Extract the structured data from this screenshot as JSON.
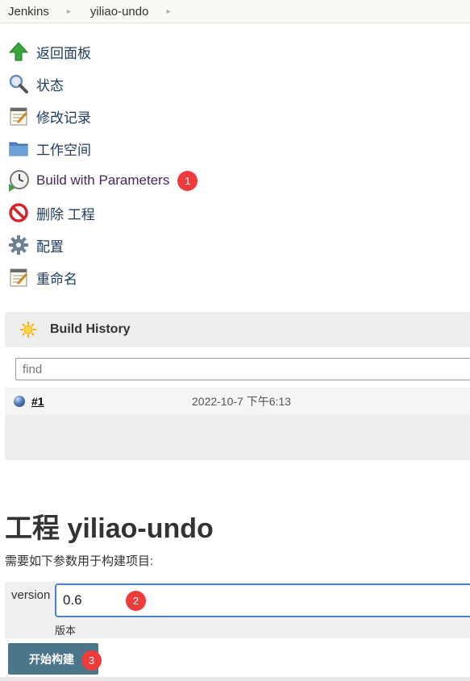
{
  "breadcrumb": {
    "items": [
      "Jenkins",
      "yiliao-undo"
    ],
    "separator": "▸"
  },
  "menu": {
    "items": [
      {
        "label": "返回面板",
        "icon": "up-arrow-icon"
      },
      {
        "label": "状态",
        "icon": "magnifier-icon"
      },
      {
        "label": "修改记录",
        "icon": "notepad-icon"
      },
      {
        "label": "工作空间",
        "icon": "folder-icon"
      },
      {
        "label": "Build with Parameters",
        "icon": "clock-play-icon",
        "badge": "1"
      },
      {
        "label": "删除 工程",
        "icon": "no-entry-icon"
      },
      {
        "label": "配置",
        "icon": "gear-icon"
      },
      {
        "label": "重命名",
        "icon": "notepad-icon"
      }
    ]
  },
  "build_history": {
    "title": "Build History",
    "find_placeholder": "find",
    "builds": [
      {
        "number": "#1",
        "date": "2022-10-7 下午6:13"
      }
    ]
  },
  "project": {
    "title": "工程 yiliao-undo",
    "description": "需要如下参数用于构建项目:"
  },
  "parameters": {
    "name": "version",
    "value": "0.6",
    "description": "版本",
    "badge": "2"
  },
  "build_button": {
    "label": "开始构建",
    "badge": "3"
  },
  "colors": {
    "accent": "#4a82c6",
    "badge": "#ee3b3b",
    "button": "#4b758b"
  }
}
